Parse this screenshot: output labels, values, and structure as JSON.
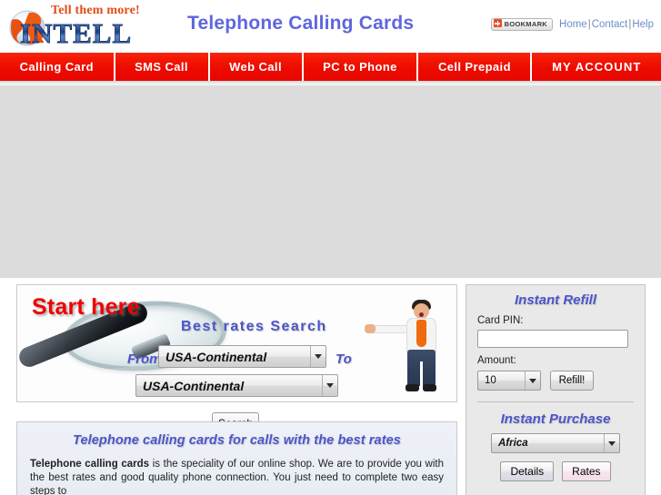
{
  "header": {
    "title": "Telephone Calling Cards",
    "logo": {
      "tagline": "Tell them more!",
      "wordmark": "INTELL",
      "globe_icon": "globe-icon"
    },
    "bookmark": {
      "label": "BOOKMARK",
      "icon": "plus-square-icon"
    },
    "links": [
      {
        "label": "Home"
      },
      {
        "label": "Contact"
      },
      {
        "label": "Help"
      }
    ],
    "separator": "|"
  },
  "nav": {
    "items": [
      {
        "label": "Calling  Card"
      },
      {
        "label": "SMS Call"
      },
      {
        "label": "Web Call"
      },
      {
        "label": "PC to Phone"
      },
      {
        "label": "Cell Prepaid"
      },
      {
        "label": "MY  ACCOUNT"
      }
    ]
  },
  "search_panel": {
    "start_here": "Start here",
    "best_rates_search": "Best  rates  Search",
    "from_label": "From:",
    "to_label": "To",
    "from_value": "USA-Continental",
    "to_value": "USA-Continental",
    "search_button": "Search",
    "magnifier_icon": "magnifier-icon",
    "boy_image": "pointing-boy-image"
  },
  "info": {
    "title": "Telephone calling cards for calls with the best rates",
    "lead": "Telephone calling cards",
    "body": " is the speciality of our online shop. We are to provide you with the best rates and good quality phone connection. You just need to complete two easy steps to"
  },
  "sidebar": {
    "instant_refill": {
      "title": "Instant Refill",
      "card_pin_label": "Card PIN:",
      "card_pin_value": "",
      "amount_label": "Amount:",
      "amount_value": "10",
      "refill_button": "Refill!"
    },
    "instant_purchase": {
      "title": "Instant Purchase",
      "country_value": "Africa",
      "details_button": "Details",
      "rates_button": "Rates"
    }
  },
  "colors": {
    "nav_red": "#ed0b00",
    "title_blue": "#5f66de",
    "accent_blue": "#4b55c8",
    "start_red": "#f00000",
    "banner_gray": "#dcdcdc"
  }
}
